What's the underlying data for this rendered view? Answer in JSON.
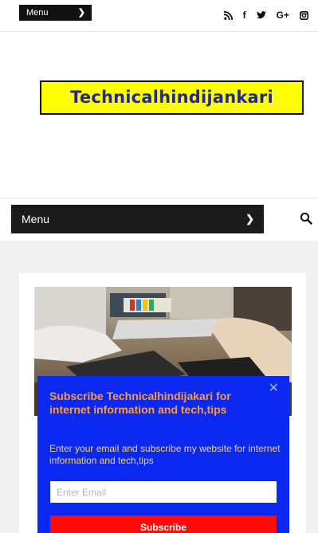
{
  "topbar": {
    "menu_label": "Menu",
    "social_icons": [
      "rss-icon",
      "facebook-icon",
      "twitter-icon",
      "google-plus-icon",
      "instagram-icon"
    ],
    "facebook_glyph": "f",
    "google_plus_glyph": "G+"
  },
  "logo": {
    "text": "Technicalhindijankari",
    "background": "#ffff00",
    "text_color": "#1f2a8c"
  },
  "main_nav": {
    "menu_label": "Menu"
  },
  "popup": {
    "title": "Subscribe Technicalhindijakari for internet information and tech,tips",
    "description": "Enter your email and subscribe my website for internet information and tech,tips",
    "email_placeholder": "Enter Email",
    "email_value": "",
    "subscribe_label": "Subscribe",
    "close_glyph": "✕",
    "background": "#0a28f0",
    "title_color": "#ff9a3c",
    "description_color": "#ffd36a",
    "button_color": "#ff0a0a"
  }
}
